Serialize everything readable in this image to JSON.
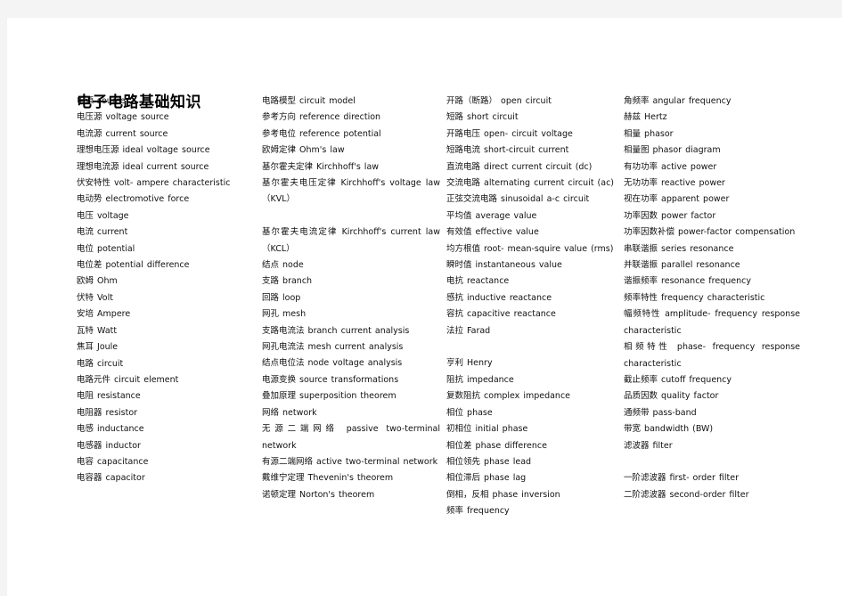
{
  "document": {
    "title": "电子电路基础知识",
    "background_color": "#f4f4f4",
    "page_color": "#ffffff",
    "text_color": "#111111"
  },
  "columns": [
    {
      "id": "column-1",
      "entries": [
        "电源 source",
        "电压源 voltage source",
        "电流源 current source",
        "理想电压源 ideal voltage source",
        "理想电流源 ideal current source",
        "伏安特性 volt- ampere characteristic",
        "电动势 electromotive force",
        "电压 voltage",
        "电流 current",
        "电位 potential",
        "电位差 potential difference",
        "欧姆 Ohm",
        "伏特 Volt",
        "安培 Ampere",
        "瓦特 Watt",
        "焦耳 Joule",
        "电路 circuit",
        "电路元件 circuit element",
        "电阻 resistance",
        "电阻器 resistor",
        "电感 inductance",
        "电感器 inductor",
        "电容 capacitance",
        "电容器 capacitor"
      ]
    },
    {
      "id": "column-2",
      "entries": [
        "电路模型 circuit model",
        "参考方向 reference direction",
        "参考电位 reference potential",
        "欧姆定律 Ohm's law",
        "基尔霍夫定律 Kirchhoff's law",
        "基尔霍夫电压定律 Kirchhoff's voltage law（KVL）",
        "",
        "基尔霍夫电流定律 Kirchhoff's current law（KCL）",
        "结点 node",
        "支路 branch",
        "回路 loop",
        "网孔 mesh",
        "支路电流法 branch current analysis",
        "网孔电流法 mesh current analysis",
        "结点电位法 node voltage analysis",
        "电源变换 source transformations",
        "叠加原理 superposition theorem",
        "网络 network",
        "无源二端网络 passive two-terminal network",
        "有源二端网络 active two-terminal network",
        "戴维宁定理 Thevenin's theorem",
        "诺顿定理 Norton's theorem"
      ]
    },
    {
      "id": "column-3",
      "entries": [
        "开路（断路）open circuit",
        "短路 short circuit",
        "开路电压 open- circuit voltage",
        "短路电流 short-circuit current",
        "直流电路 direct current circuit (dc)",
        "交流电路 alternating current circuit (ac)",
        "正弦交流电路 sinusoidal a-c circuit",
        "平均值 average value",
        "有效值 effective value",
        "均方根值 root- mean-squire value (rms)",
        "瞬时值 instantaneous value",
        "电抗 reactance",
        "感抗 inductive reactance",
        "容抗 capacitive reactance",
        "法拉 Farad",
        "",
        "亨利 Henry",
        "阻抗 impedance",
        "复数阻抗 complex impedance",
        "相位 phase",
        "初相位 initial phase",
        "相位差 phase difference",
        "相位领先 phase lead",
        "相位滞后 phase lag",
        "倒相，反相 phase inversion",
        "频率 frequency"
      ]
    },
    {
      "id": "column-4",
      "entries": [
        "角频率 angular frequency",
        "赫兹 Hertz",
        "相量 phasor",
        "相量图 phasor diagram",
        "有功功率 active power",
        "无功功率 reactive power",
        "视在功率 apparent power",
        "功率因数 power factor",
        "功率因数补偿 power-factor compensation",
        "串联谐振 series resonance",
        "并联谐振 parallel resonance",
        "谐振频率 resonance frequency",
        "频率特性 frequency characteristic",
        "幅频特性 amplitude- frequency response characteristic",
        "相频特性 phase- frequency response characteristic",
        "截止频率 cutoff frequency",
        "品质因数 quality factor",
        "通频带 pass-band",
        "带宽 bandwidth (BW)",
        "滤波器 filter",
        "",
        "一阶滤波器 first- order filter",
        "二阶滤波器 second-order filter"
      ]
    }
  ]
}
